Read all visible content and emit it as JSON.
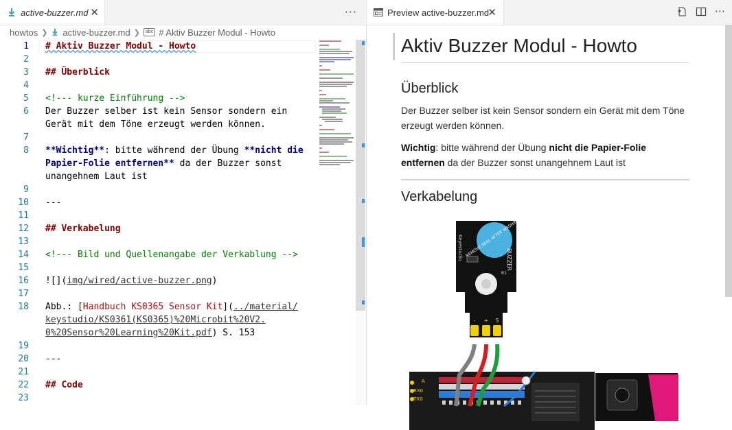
{
  "editor": {
    "tab_label": "active-buzzer.md",
    "more_label": "···",
    "breadcrumb": {
      "folder": "howtos",
      "file": "active-buzzer.md",
      "symbol": "# Aktiv Buzzer Modul - Howto"
    },
    "line_numbers": [
      "1",
      "2",
      "3",
      "4",
      "5",
      "6",
      "7",
      "8",
      "9",
      "10",
      "11",
      "12",
      "13",
      "14",
      "15",
      "16",
      "17",
      "18",
      "19",
      "20",
      "21",
      "22",
      "23"
    ],
    "lines": {
      "l1": "# Aktiv Buzzer Modul - Howto",
      "l3": "## Überblick",
      "l5": "<!--- kurze Einführung -->",
      "l6a": "Der Buzzer selber ist kein Sensor sondern ein",
      "l6b": "Gerät mit dem Töne erzeugt werden können.",
      "l8a_bold": "**Wichtig**",
      "l8a_mid": ": bitte während der Übung ",
      "l8a_bold2": "**nicht die",
      "l8b_bold": "Papier-Folie entfernen**",
      "l8b_rest": " da der Buzzer sonst",
      "l8c": "unangehnem Laut ist",
      "l10": "---",
      "l12": "## Verkabelung",
      "l14": "<!--- Bild und Quellenangabe der Verkablung -->",
      "l16a": "![](",
      "l16b": "img/wired/active-buzzer.png",
      "l16c": ")",
      "l18a_pre": "Abb.: [",
      "l18a_link": "Handbuch KS0365 Sensor Kit",
      "l18a_mid": "](",
      "l18a_url": "../material/",
      "l18b_url": "keystudio/KS0361(KS0365)%20Microbit%20V2.",
      "l18c_url": "0%20Sensor%20Learning%20Kit.pdf",
      "l18c_rest": ") S. 153",
      "l20": "---",
      "l22": "## Code"
    }
  },
  "preview": {
    "tab_label": "Preview active-buzzer.md",
    "more_label": "···",
    "h1": "Aktiv Buzzer Modul - Howto",
    "h2_overview": "Überblick",
    "p1": "Der Buzzer selber ist kein Sensor sondern ein Gerät mit dem Töne erzeugt werden können.",
    "p2_b1": "Wichtig",
    "p2_t1": ": bitte während der Übung ",
    "p2_b2": "nicht die Papier-Folie entfernen",
    "p2_t2": " da der Buzzer sonst unangehnem Laut ist",
    "h2_wiring": "Verkabelung",
    "image": {
      "module_label": "BUZZER",
      "brand_label": "Keyestudio",
      "sticker_text": "REMOVE SEAL AFTER WASHING",
      "pin_labels": [
        "-",
        "+",
        "S"
      ],
      "r1_label": "R1",
      "board_labels": [
        "A",
        "RX0",
        "TX0"
      ],
      "colors": {
        "module": "#111111",
        "pins": "#f0d000",
        "wire_grey": "#7f7f7f",
        "wire_red": "#d42020",
        "wire_green": "#1f9d3d",
        "board": "#1a1a1a",
        "microbit": "#e0187a"
      }
    }
  }
}
